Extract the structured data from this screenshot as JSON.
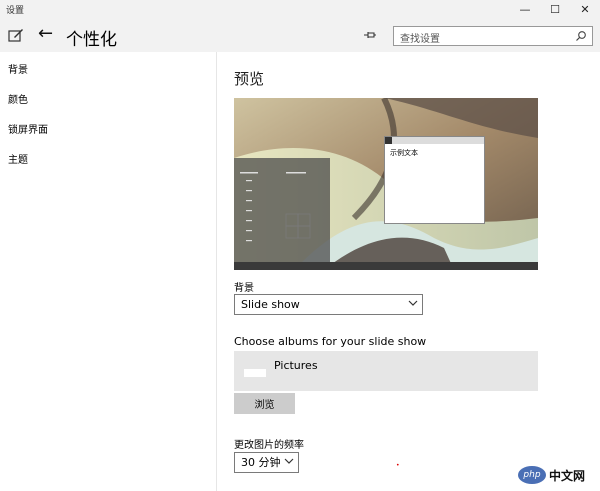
{
  "window": {
    "title": "设置",
    "minimize_glyph": "—",
    "maximize_glyph": "☐",
    "close_glyph": "✕"
  },
  "header": {
    "back_glyph": "←",
    "title": "个性化",
    "search_placeholder": "查找设置"
  },
  "sidebar": {
    "items": [
      {
        "label": "背景"
      },
      {
        "label": "颜色"
      },
      {
        "label": "锁屏界面"
      },
      {
        "label": "主题"
      }
    ]
  },
  "main": {
    "preview_heading": "预览",
    "sample_text": "示例文本",
    "background_label": "背景",
    "background_value": "Slide show",
    "albums_label": "Choose albums for your slide show",
    "album_name": "Pictures",
    "browse_label": "浏览",
    "frequency_label": "更改图片的频率",
    "frequency_value": "30 分钟"
  },
  "watermark": {
    "logo_text": "php",
    "site_text": "中文网"
  },
  "icons": {
    "settings": "pen-tablet-icon",
    "back": "back-arrow-icon",
    "pin": "pin-icon",
    "search": "search-icon",
    "chevron": "chevron-down-icon"
  }
}
